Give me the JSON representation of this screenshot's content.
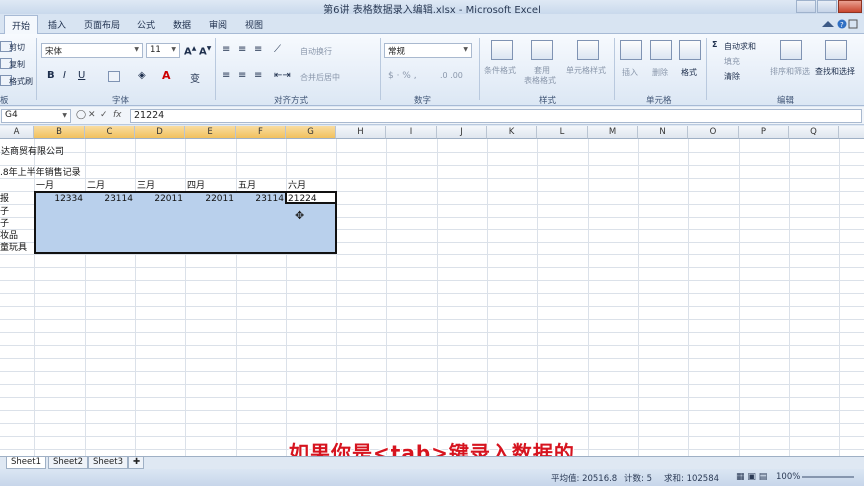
{
  "window": {
    "title": "第6讲 表格数据录入编辑.xlsx - Microsoft Excel"
  },
  "ribbon_tabs": [
    "开始",
    "插入",
    "页面布局",
    "公式",
    "数据",
    "审阅",
    "视图"
  ],
  "clipboard": {
    "cut": "剪切",
    "copy": "复制",
    "format_painter": "格式刷",
    "group": "板"
  },
  "font": {
    "name": "宋体",
    "size": "11",
    "group": "字体"
  },
  "alignment": {
    "wrap": "自动换行",
    "merge": "合并后居中",
    "group": "对齐方式"
  },
  "number": {
    "format": "常规",
    "group": "数字"
  },
  "styles": {
    "cond": "条件格式",
    "table1": "套用",
    "table2": "表格格式",
    "cell": "单元格样式",
    "group": "样式"
  },
  "cells": {
    "insert": "插入",
    "delete": "删除",
    "format": "格式",
    "group": "单元格"
  },
  "editing": {
    "autosum": "自动求和",
    "fill": "填充",
    "clear": "清除",
    "sort": "排序和筛选",
    "find": "查找和选择",
    "group": "编辑"
  },
  "formula_bar": {
    "name_box": "G4",
    "formula": "21224"
  },
  "columns": [
    "A",
    "B",
    "C",
    "D",
    "E",
    "F",
    "G",
    "H",
    "I",
    "J",
    "K",
    "L",
    "M",
    "N",
    "O",
    "P",
    "Q"
  ],
  "sheet": {
    "company": "达商贸有限公司",
    "record_title": ".8年上半年销售记录",
    "months": [
      "一月",
      "二月",
      "三月",
      "四月",
      "五月",
      "六月"
    ],
    "row_labels": [
      "报",
      "子",
      "子",
      "妆品",
      "童玩具"
    ],
    "row1_values": [
      "12334",
      "23114",
      "22011",
      "22011",
      "23114",
      "21224"
    ]
  },
  "sheets": [
    "Sheet1",
    "Sheet2",
    "Sheet3"
  ],
  "status": {
    "average": "平均值: 20516.8",
    "count": "计数: 5",
    "sum": "求和: 102584",
    "zoom": "100%"
  },
  "subtitle": "如果你是<tab>键录入数据的"
}
